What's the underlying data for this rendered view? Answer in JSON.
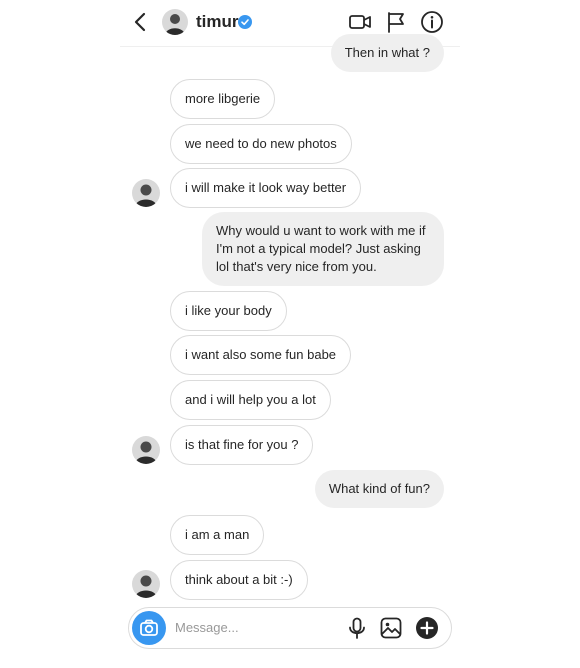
{
  "header": {
    "username": "timur",
    "back_icon": "chevron-left-icon",
    "verified_icon": "verified-badge-icon",
    "actions": [
      "video-call-icon",
      "flag-icon",
      "info-icon"
    ]
  },
  "messages": [
    {
      "from": "me",
      "text": "Then in what ?"
    },
    {
      "from": "them",
      "text": "more libgerie"
    },
    {
      "from": "them",
      "text": "we need to do new photos"
    },
    {
      "from": "them",
      "text": "i will make it look way better"
    },
    {
      "from": "me",
      "text": "Why would u want to work with me if I'm not a typical model? Just asking lol that's very nice from you."
    },
    {
      "from": "them",
      "text": "i like your body"
    },
    {
      "from": "them",
      "text": "i want also some fun babe"
    },
    {
      "from": "them",
      "text": "and i will help you a lot"
    },
    {
      "from": "them",
      "text": "is that fine for you ?"
    },
    {
      "from": "me",
      "text": "What kind of fun?"
    },
    {
      "from": "them",
      "text": "i am a man"
    },
    {
      "from": "them",
      "text": "think about a bit :-)"
    }
  ],
  "composer": {
    "placeholder": "Message...",
    "icons": [
      "camera-icon",
      "microphone-icon",
      "gallery-icon",
      "add-icon"
    ],
    "accent": "#3897f0"
  }
}
